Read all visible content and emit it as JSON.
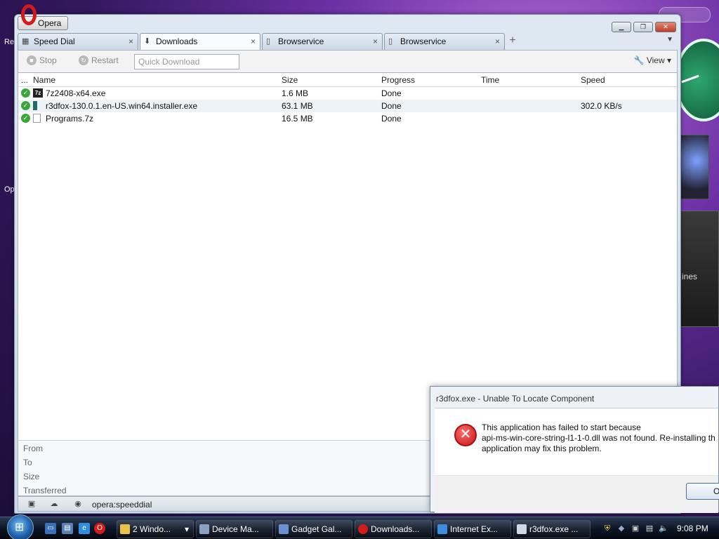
{
  "desktop": {
    "left_fragments": [
      "Re",
      "Op"
    ],
    "right_gadget_text": "ines"
  },
  "window": {
    "title": "Opera"
  },
  "tabs": [
    {
      "label": "Speed Dial",
      "icon": "grid-icon"
    },
    {
      "label": "Downloads",
      "icon": "download-icon"
    },
    {
      "label": "Browservice",
      "icon": "page-icon"
    },
    {
      "label": "Browservice",
      "icon": "page-icon"
    }
  ],
  "toolbar": {
    "stop_label": "Stop",
    "restart_label": "Restart",
    "quick_download_placeholder": "Quick Download",
    "view_label": "View"
  },
  "list": {
    "columns": {
      "menu": "...",
      "name": "Name",
      "size": "Size",
      "progress": "Progress",
      "time": "Time",
      "speed": "Speed"
    },
    "rows": [
      {
        "name": "7z2408-x64.exe",
        "size": "1.6 MB",
        "progress": "Done",
        "time": "",
        "speed": ""
      },
      {
        "name": "r3dfox-130.0.1.en-US.win64.installer.exe",
        "size": "63.1 MB",
        "progress": "Done",
        "time": "",
        "speed": "302.0 KB/s"
      },
      {
        "name": "Programs.7z",
        "size": "16.5 MB",
        "progress": "Done",
        "time": "",
        "speed": ""
      }
    ]
  },
  "details": {
    "from": "From",
    "to": "To",
    "size": "Size",
    "transferred": "Transferred"
  },
  "statusbar": {
    "address": "opera:speeddial"
  },
  "dialog": {
    "title": "r3dfox.exe - Unable To Locate Component",
    "message": "This application has failed to start because\napi-ms-win-core-string-l1-1-0.dll was not found. Re-installing th\napplication may fix this problem.",
    "ok_label": "Ol"
  },
  "taskbar": {
    "buttons": [
      {
        "label": "2 Windo...",
        "icon": "folder-icon",
        "color": "#e8c24a"
      },
      {
        "label": "Device Ma...",
        "icon": "device-manager-icon",
        "color": "#8aa2c2"
      },
      {
        "label": "Gadget Gal...",
        "icon": "gadget-icon",
        "color": "#6b8fd0"
      },
      {
        "label": "Downloads...",
        "icon": "opera-icon",
        "color": "#d21b1b"
      },
      {
        "label": "Internet Ex...",
        "icon": "ie-icon",
        "color": "#3a8de0"
      },
      {
        "label": "r3dfox.exe ...",
        "icon": "app-window-icon",
        "color": "#cfd8e4"
      }
    ],
    "clock": "9:08 PM"
  }
}
